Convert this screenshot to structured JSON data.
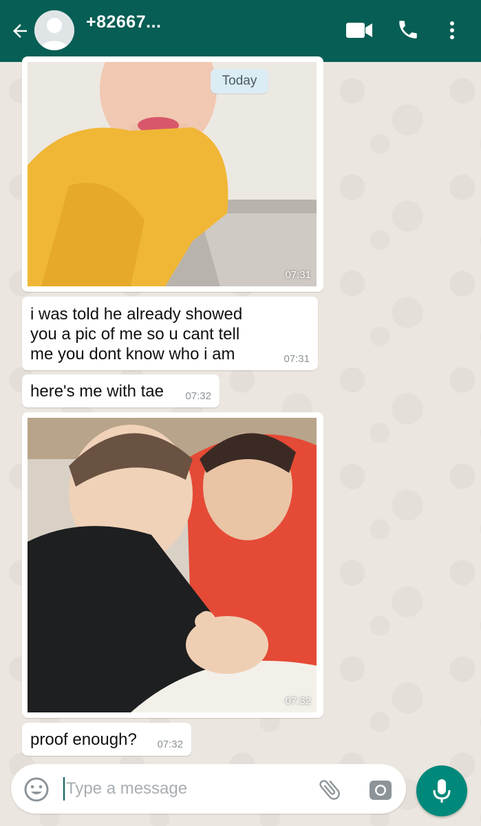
{
  "header": {
    "contact_name": "+82667...",
    "back_icon": "arrow-left-icon",
    "video_icon": "video-camera-icon",
    "call_icon": "phone-icon",
    "more_icon": "more-vertical-icon",
    "color": "#075e54"
  },
  "date_chip": "Today",
  "messages": [
    {
      "type": "image",
      "description_icon": "photo",
      "time": "07:31"
    },
    {
      "type": "text",
      "lines": [
        "i was told he already showed",
        "you a pic of me so u cant tell",
        "me you dont know who i am"
      ],
      "time": "07:31"
    },
    {
      "type": "text",
      "lines": [
        "here's me with tae"
      ],
      "time": "07:32"
    },
    {
      "type": "image",
      "description_icon": "photo",
      "time": "07:32"
    },
    {
      "type": "text",
      "lines": [
        "proof enough?"
      ],
      "time": "07:32"
    }
  ],
  "input": {
    "placeholder": "Type a message",
    "value": ""
  },
  "icons": {
    "emoji": "emoji-icon",
    "attach": "paperclip-icon",
    "camera": "camera-icon",
    "mic": "microphone-icon"
  },
  "colors": {
    "accent": "#00897b",
    "bubble": "#ffffff",
    "date_chip": "#dcecf5"
  }
}
